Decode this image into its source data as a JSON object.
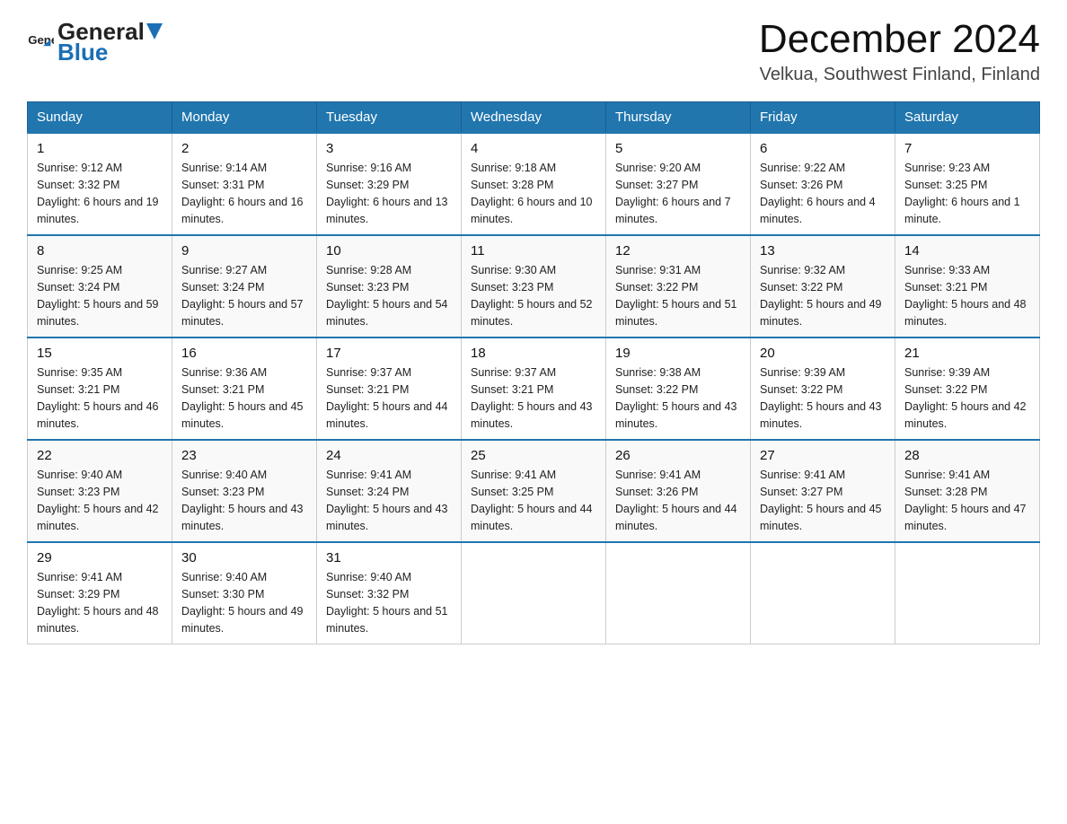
{
  "header": {
    "logo": {
      "text_general": "General",
      "text_blue": "Blue",
      "icon_alt": "GeneralBlue logo"
    },
    "title": "December 2024",
    "subtitle": "Velkua, Southwest Finland, Finland"
  },
  "calendar": {
    "days_of_week": [
      "Sunday",
      "Monday",
      "Tuesday",
      "Wednesday",
      "Thursday",
      "Friday",
      "Saturday"
    ],
    "weeks": [
      [
        {
          "date": "1",
          "sunrise": "9:12 AM",
          "sunset": "3:32 PM",
          "daylight": "6 hours and 19 minutes."
        },
        {
          "date": "2",
          "sunrise": "9:14 AM",
          "sunset": "3:31 PM",
          "daylight": "6 hours and 16 minutes."
        },
        {
          "date": "3",
          "sunrise": "9:16 AM",
          "sunset": "3:29 PM",
          "daylight": "6 hours and 13 minutes."
        },
        {
          "date": "4",
          "sunrise": "9:18 AM",
          "sunset": "3:28 PM",
          "daylight": "6 hours and 10 minutes."
        },
        {
          "date": "5",
          "sunrise": "9:20 AM",
          "sunset": "3:27 PM",
          "daylight": "6 hours and 7 minutes."
        },
        {
          "date": "6",
          "sunrise": "9:22 AM",
          "sunset": "3:26 PM",
          "daylight": "6 hours and 4 minutes."
        },
        {
          "date": "7",
          "sunrise": "9:23 AM",
          "sunset": "3:25 PM",
          "daylight": "6 hours and 1 minute."
        }
      ],
      [
        {
          "date": "8",
          "sunrise": "9:25 AM",
          "sunset": "3:24 PM",
          "daylight": "5 hours and 59 minutes."
        },
        {
          "date": "9",
          "sunrise": "9:27 AM",
          "sunset": "3:24 PM",
          "daylight": "5 hours and 57 minutes."
        },
        {
          "date": "10",
          "sunrise": "9:28 AM",
          "sunset": "3:23 PM",
          "daylight": "5 hours and 54 minutes."
        },
        {
          "date": "11",
          "sunrise": "9:30 AM",
          "sunset": "3:23 PM",
          "daylight": "5 hours and 52 minutes."
        },
        {
          "date": "12",
          "sunrise": "9:31 AM",
          "sunset": "3:22 PM",
          "daylight": "5 hours and 51 minutes."
        },
        {
          "date": "13",
          "sunrise": "9:32 AM",
          "sunset": "3:22 PM",
          "daylight": "5 hours and 49 minutes."
        },
        {
          "date": "14",
          "sunrise": "9:33 AM",
          "sunset": "3:21 PM",
          "daylight": "5 hours and 48 minutes."
        }
      ],
      [
        {
          "date": "15",
          "sunrise": "9:35 AM",
          "sunset": "3:21 PM",
          "daylight": "5 hours and 46 minutes."
        },
        {
          "date": "16",
          "sunrise": "9:36 AM",
          "sunset": "3:21 PM",
          "daylight": "5 hours and 45 minutes."
        },
        {
          "date": "17",
          "sunrise": "9:37 AM",
          "sunset": "3:21 PM",
          "daylight": "5 hours and 44 minutes."
        },
        {
          "date": "18",
          "sunrise": "9:37 AM",
          "sunset": "3:21 PM",
          "daylight": "5 hours and 43 minutes."
        },
        {
          "date": "19",
          "sunrise": "9:38 AM",
          "sunset": "3:22 PM",
          "daylight": "5 hours and 43 minutes."
        },
        {
          "date": "20",
          "sunrise": "9:39 AM",
          "sunset": "3:22 PM",
          "daylight": "5 hours and 43 minutes."
        },
        {
          "date": "21",
          "sunrise": "9:39 AM",
          "sunset": "3:22 PM",
          "daylight": "5 hours and 42 minutes."
        }
      ],
      [
        {
          "date": "22",
          "sunrise": "9:40 AM",
          "sunset": "3:23 PM",
          "daylight": "5 hours and 42 minutes."
        },
        {
          "date": "23",
          "sunrise": "9:40 AM",
          "sunset": "3:23 PM",
          "daylight": "5 hours and 43 minutes."
        },
        {
          "date": "24",
          "sunrise": "9:41 AM",
          "sunset": "3:24 PM",
          "daylight": "5 hours and 43 minutes."
        },
        {
          "date": "25",
          "sunrise": "9:41 AM",
          "sunset": "3:25 PM",
          "daylight": "5 hours and 44 minutes."
        },
        {
          "date": "26",
          "sunrise": "9:41 AM",
          "sunset": "3:26 PM",
          "daylight": "5 hours and 44 minutes."
        },
        {
          "date": "27",
          "sunrise": "9:41 AM",
          "sunset": "3:27 PM",
          "daylight": "5 hours and 45 minutes."
        },
        {
          "date": "28",
          "sunrise": "9:41 AM",
          "sunset": "3:28 PM",
          "daylight": "5 hours and 47 minutes."
        }
      ],
      [
        {
          "date": "29",
          "sunrise": "9:41 AM",
          "sunset": "3:29 PM",
          "daylight": "5 hours and 48 minutes."
        },
        {
          "date": "30",
          "sunrise": "9:40 AM",
          "sunset": "3:30 PM",
          "daylight": "5 hours and 49 minutes."
        },
        {
          "date": "31",
          "sunrise": "9:40 AM",
          "sunset": "3:32 PM",
          "daylight": "5 hours and 51 minutes."
        },
        null,
        null,
        null,
        null
      ]
    ]
  }
}
